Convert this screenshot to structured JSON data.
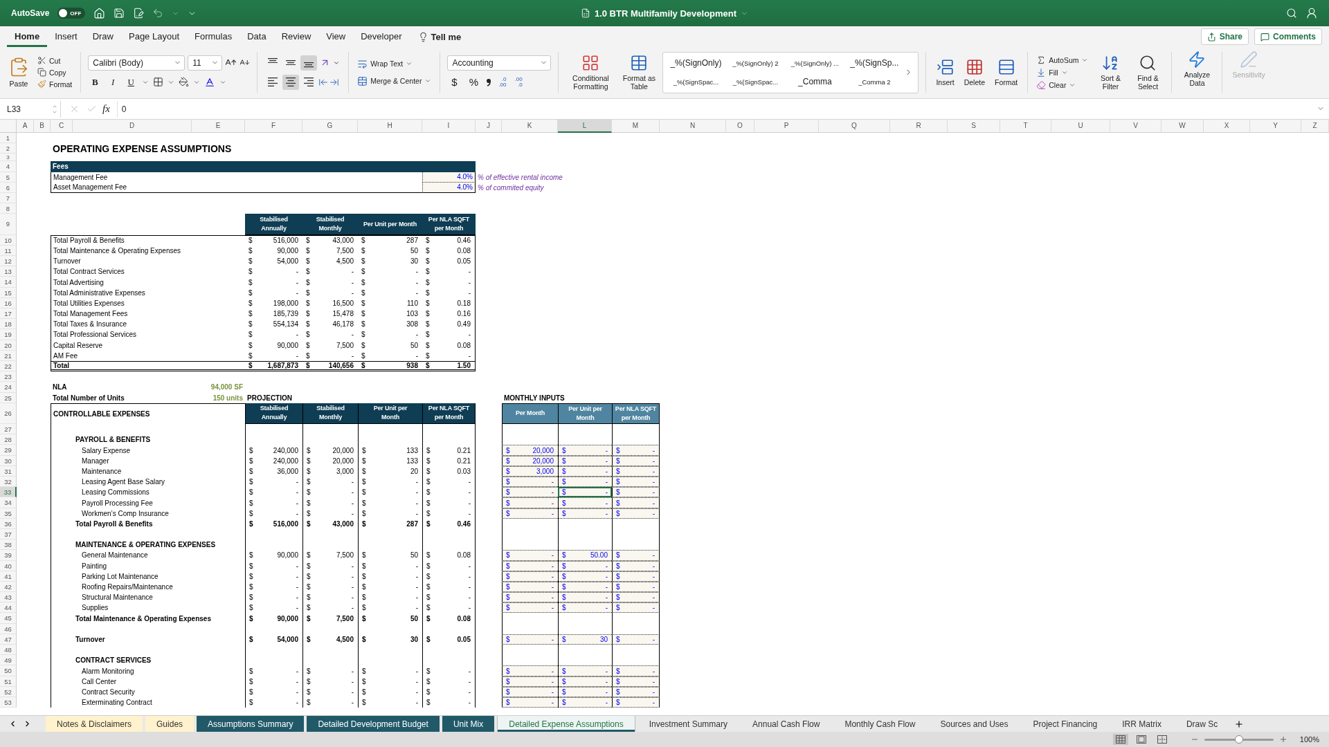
{
  "title_bar": {
    "autosave": "AutoSave",
    "autosave_on": false,
    "autosave_state": "OFF",
    "title": "1.0 BTR Multifamily Development"
  },
  "menu_tabs": [
    {
      "label": "Home",
      "selected": true
    },
    {
      "label": "Insert",
      "selected": false
    },
    {
      "label": "Draw",
      "selected": false
    },
    {
      "label": "Page Layout",
      "selected": false
    },
    {
      "label": "Formulas",
      "selected": false
    },
    {
      "label": "Data",
      "selected": false
    },
    {
      "label": "Review",
      "selected": false
    },
    {
      "label": "View",
      "selected": false
    },
    {
      "label": "Developer",
      "selected": false
    }
  ],
  "tell_me": "Tell me",
  "share": "Share",
  "comments": "Comments",
  "ribbon": {
    "paste": "Paste",
    "clipboard": [
      "Cut",
      "Copy",
      "Format"
    ],
    "font_name": "Calibri (Body)",
    "font_size": "11",
    "format_buttons": [
      "B",
      "I",
      "U"
    ],
    "vertical_align": [
      {
        "kind": "top",
        "selected": false
      },
      {
        "kind": "middle",
        "selected": false
      },
      {
        "kind": "bottom",
        "selected": true
      }
    ],
    "horizontal_align": [
      {
        "kind": "left",
        "selected": false
      },
      {
        "kind": "center",
        "selected": true
      },
      {
        "kind": "right",
        "selected": false
      }
    ],
    "wrap_text": "Wrap Text",
    "merge": "Merge & Center",
    "number_format": "Accounting",
    "number_buttons": [
      "$",
      "%"
    ],
    "decimals": [
      {
        "a": ".0",
        "b": ".00"
      },
      {
        "a": ".00",
        "b": ".0"
      }
    ],
    "conditional": "Conditional Formatting",
    "format_table": "Format as Table",
    "cell_styles": [
      "_%(SignOnly)",
      "_%(SignOnly) 2",
      "_%(SignOnly) ...",
      "_%(SignSp...",
      "_%(SignSpac...",
      "_%(SignSpac...",
      "_Comma",
      "_Comma 2"
    ],
    "cells": [
      "Insert",
      "Delete",
      "Format"
    ],
    "editing": [
      "AutoSum",
      "Fill",
      "Clear"
    ],
    "sort": "Sort & Filter",
    "find": "Find & Select",
    "analyze": "Analyze Data",
    "sensitivity": {
      "label": "Sensitivity",
      "disabled": true
    }
  },
  "formula_bar": {
    "name_box": "L33",
    "fx": "fx",
    "value": "0"
  },
  "columns": [
    {
      "label": "A",
      "selected": false
    },
    {
      "label": "B",
      "selected": false
    },
    {
      "label": "C",
      "selected": false
    },
    {
      "label": "D",
      "selected": false
    },
    {
      "label": "E",
      "selected": false
    },
    {
      "label": "F",
      "selected": false
    },
    {
      "label": "G",
      "selected": false
    },
    {
      "label": "H",
      "selected": false
    },
    {
      "label": "I",
      "selected": false
    },
    {
      "label": "J",
      "selected": false
    },
    {
      "label": "K",
      "selected": false
    },
    {
      "label": "L",
      "selected": true
    },
    {
      "label": "M",
      "selected": false
    },
    {
      "label": "N",
      "selected": false
    },
    {
      "label": "O",
      "selected": false
    },
    {
      "label": "P",
      "selected": false
    },
    {
      "label": "Q",
      "selected": false
    },
    {
      "label": "R",
      "selected": false
    },
    {
      "label": "S",
      "selected": false
    },
    {
      "label": "T",
      "selected": false
    },
    {
      "label": "U",
      "selected": false
    },
    {
      "label": "V",
      "selected": false
    },
    {
      "label": "W",
      "selected": false
    },
    {
      "label": "X",
      "selected": false
    },
    {
      "label": "Y",
      "selected": false
    },
    {
      "label": "Z",
      "selected": false
    }
  ],
  "rows": [
    {
      "n": "1",
      "selected": false,
      "kind": "blank"
    },
    {
      "n": "2",
      "selected": false,
      "kind": "title",
      "text": "OPERATING EXPENSE ASSUMPTIONS"
    },
    {
      "n": "3",
      "selected": false,
      "kind": "spacer"
    },
    {
      "n": "4",
      "selected": false,
      "kind": "fees_header",
      "text": "Fees"
    },
    {
      "n": "5",
      "selected": false,
      "kind": "fee",
      "label": "Management Fee",
      "value": "4.0%",
      "note": "% of effective rental income"
    },
    {
      "n": "6",
      "selected": false,
      "kind": "fee",
      "label": "Asset Management Fee",
      "value": "4.0%",
      "note": "% of commited equity"
    },
    {
      "n": "7",
      "selected": false,
      "kind": "blank"
    },
    {
      "n": "8",
      "selected": false,
      "kind": "blank"
    },
    {
      "n": "9",
      "selected": false,
      "kind": "summary_header",
      "headers": [
        "Stabilised Annually",
        "Stabilised Monthly",
        "Per Unit per Month",
        "Per NLA SQFT per Month"
      ]
    },
    {
      "n": "10",
      "selected": false,
      "kind": "summary",
      "label": "Total Payroll & Benefits",
      "values": [
        [
          "$",
          "516,000"
        ],
        [
          "$",
          "43,000"
        ],
        [
          "$",
          "287"
        ],
        [
          "$",
          "0.46"
        ]
      ]
    },
    {
      "n": "11",
      "selected": false,
      "kind": "summary",
      "label": "Total Maintenance & Operating Expenses",
      "values": [
        [
          "$",
          "90,000"
        ],
        [
          "$",
          "7,500"
        ],
        [
          "$",
          "50"
        ],
        [
          "$",
          "0.08"
        ]
      ]
    },
    {
      "n": "12",
      "selected": false,
      "kind": "summary",
      "label": "Turnover",
      "values": [
        [
          "$",
          "54,000"
        ],
        [
          "$",
          "4,500"
        ],
        [
          "$",
          "30"
        ],
        [
          "$",
          "0.05"
        ]
      ]
    },
    {
      "n": "13",
      "selected": false,
      "kind": "summary",
      "label": "Total Contract Services",
      "values": [
        [
          "$",
          "-"
        ],
        [
          "$",
          "-"
        ],
        [
          "$",
          "-"
        ],
        [
          "$",
          "-"
        ]
      ]
    },
    {
      "n": "14",
      "selected": false,
      "kind": "summary",
      "label": "Total Advertising",
      "values": [
        [
          "$",
          "-"
        ],
        [
          "$",
          "-"
        ],
        [
          "$",
          "-"
        ],
        [
          "$",
          "-"
        ]
      ]
    },
    {
      "n": "15",
      "selected": false,
      "kind": "summary",
      "label": "Total Administrative Expenses",
      "values": [
        [
          "$",
          "-"
        ],
        [
          "$",
          "-"
        ],
        [
          "$",
          "-"
        ],
        [
          "$",
          "-"
        ]
      ]
    },
    {
      "n": "16",
      "selected": false,
      "kind": "summary",
      "label": "Total Utilities Expenses",
      "values": [
        [
          "$",
          "198,000"
        ],
        [
          "$",
          "16,500"
        ],
        [
          "$",
          "110"
        ],
        [
          "$",
          "0.18"
        ]
      ]
    },
    {
      "n": "17",
      "selected": false,
      "kind": "summary",
      "label": "Total Management Fees",
      "values": [
        [
          "$",
          "185,739"
        ],
        [
          "$",
          "15,478"
        ],
        [
          "$",
          "103"
        ],
        [
          "$",
          "0.16"
        ]
      ]
    },
    {
      "n": "18",
      "selected": false,
      "kind": "summary",
      "label": "Total Taxes & Insurance",
      "values": [
        [
          "$",
          "554,134"
        ],
        [
          "$",
          "46,178"
        ],
        [
          "$",
          "308"
        ],
        [
          "$",
          "0.49"
        ]
      ]
    },
    {
      "n": "19",
      "selected": false,
      "kind": "summary",
      "label": "Total Professional Services",
      "values": [
        [
          "$",
          "-"
        ],
        [
          "$",
          "-"
        ],
        [
          "$",
          "-"
        ],
        [
          "$",
          "-"
        ]
      ]
    },
    {
      "n": "20",
      "selected": false,
      "kind": "summary",
      "label": "Capital Reserve",
      "values": [
        [
          "$",
          "90,000"
        ],
        [
          "$",
          "7,500"
        ],
        [
          "$",
          "50"
        ],
        [
          "$",
          "0.08"
        ]
      ]
    },
    {
      "n": "21",
      "selected": false,
      "kind": "summary",
      "label": "AM Fee",
      "values": [
        [
          "$",
          "-"
        ],
        [
          "$",
          "-"
        ],
        [
          "$",
          "-"
        ],
        [
          "$",
          "-"
        ]
      ]
    },
    {
      "n": "22",
      "selected": false,
      "kind": "summary_total",
      "label": "Total",
      "values": [
        [
          "$",
          "1,687,873"
        ],
        [
          "$",
          "140,656"
        ],
        [
          "$",
          "938"
        ],
        [
          "$",
          "1.50"
        ]
      ]
    },
    {
      "n": "23",
      "selected": false,
      "kind": "blank"
    },
    {
      "n": "24",
      "selected": false,
      "kind": "info",
      "label": "NLA",
      "value": "94,000 SF"
    },
    {
      "n": "25",
      "selected": false,
      "kind": "info",
      "label": "Total Number of Units",
      "value": "150 units",
      "projection": "PROJECTION",
      "inputs_title": "MONTHLY INPUTS"
    },
    {
      "n": "26",
      "selected": false,
      "kind": "proj_header",
      "label": "CONTROLLABLE EXPENSES",
      "headers": [
        "Stabilised Annually",
        "Stabilised Monthly",
        "Per Unit per Month",
        "Per NLA SQFT per Month"
      ],
      "input_headers": [
        "Per Month",
        "Per Unit per Month",
        "Per NLA SQFT per Month"
      ]
    },
    {
      "n": "27",
      "selected": false,
      "kind": "proj_blank"
    },
    {
      "n": "28",
      "selected": false,
      "kind": "section",
      "label": "PAYROLL & BENEFITS"
    },
    {
      "n": "29",
      "selected": false,
      "kind": "item",
      "label": "Salary Expense",
      "values": [
        [
          "$",
          "240,000"
        ],
        [
          "$",
          "20,000"
        ],
        [
          "$",
          "133"
        ],
        [
          "$",
          "0.21"
        ]
      ],
      "inputs": [
        {
          "sign": "$",
          "value": "20,000",
          "selected": false
        },
        {
          "sign": "$",
          "value": "-",
          "selected": false
        },
        {
          "sign": "$",
          "value": "-",
          "selected": false
        }
      ]
    },
    {
      "n": "30",
      "selected": false,
      "kind": "item",
      "label": "Manager",
      "values": [
        [
          "$",
          "240,000"
        ],
        [
          "$",
          "20,000"
        ],
        [
          "$",
          "133"
        ],
        [
          "$",
          "0.21"
        ]
      ],
      "inputs": [
        {
          "sign": "$",
          "value": "20,000",
          "selected": false
        },
        {
          "sign": "$",
          "value": "-",
          "selected": false
        },
        {
          "sign": "$",
          "value": "-",
          "selected": false
        }
      ]
    },
    {
      "n": "31",
      "selected": false,
      "kind": "item",
      "label": "Maintenance",
      "values": [
        [
          "$",
          "36,000"
        ],
        [
          "$",
          "3,000"
        ],
        [
          "$",
          "20"
        ],
        [
          "$",
          "0.03"
        ]
      ],
      "inputs": [
        {
          "sign": "$",
          "value": "3,000",
          "selected": false
        },
        {
          "sign": "$",
          "value": "-",
          "selected": false
        },
        {
          "sign": "$",
          "value": "-",
          "selected": false
        }
      ]
    },
    {
      "n": "32",
      "selected": false,
      "kind": "item",
      "label": "Leasing Agent Base Salary",
      "values": [
        [
          "$",
          "-"
        ],
        [
          "$",
          "-"
        ],
        [
          "$",
          "-"
        ],
        [
          "$",
          "-"
        ]
      ],
      "inputs": [
        {
          "sign": "$",
          "value": "-",
          "selected": false
        },
        {
          "sign": "$",
          "value": "-",
          "selected": false
        },
        {
          "sign": "$",
          "value": "-",
          "selected": false
        }
      ]
    },
    {
      "n": "33",
      "selected": true,
      "kind": "item",
      "label": "Leasing Commissions",
      "values": [
        [
          "$",
          "-"
        ],
        [
          "$",
          "-"
        ],
        [
          "$",
          "-"
        ],
        [
          "$",
          "-"
        ]
      ],
      "inputs": [
        {
          "sign": "$",
          "value": "-",
          "selected": false
        },
        {
          "sign": "$",
          "value": "-",
          "selected": true
        },
        {
          "sign": "$",
          "value": "-",
          "selected": false
        }
      ]
    },
    {
      "n": "34",
      "selected": false,
      "kind": "item",
      "label": "Payroll Processing Fee",
      "values": [
        [
          "$",
          "-"
        ],
        [
          "$",
          "-"
        ],
        [
          "$",
          "-"
        ],
        [
          "$",
          "-"
        ]
      ],
      "inputs": [
        {
          "sign": "$",
          "value": "-",
          "selected": false
        },
        {
          "sign": "$",
          "value": "-",
          "selected": false
        },
        {
          "sign": "$",
          "value": "-",
          "selected": false
        }
      ]
    },
    {
      "n": "35",
      "selected": false,
      "kind": "item",
      "label": "Workmen’s Comp Insurance",
      "values": [
        [
          "$",
          "-"
        ],
        [
          "$",
          "-"
        ],
        [
          "$",
          "-"
        ],
        [
          "$",
          "-"
        ]
      ],
      "inputs": [
        {
          "sign": "$",
          "value": "-",
          "selected": false
        },
        {
          "sign": "$",
          "value": "-",
          "selected": false
        },
        {
          "sign": "$",
          "value": "-",
          "selected": false
        }
      ]
    },
    {
      "n": "36",
      "selected": false,
      "kind": "subtotal",
      "label": "Total Payroll & Benefits",
      "values": [
        [
          "$",
          "516,000"
        ],
        [
          "$",
          "43,000"
        ],
        [
          "$",
          "287"
        ],
        [
          "$",
          "0.46"
        ]
      ]
    },
    {
      "n": "37",
      "selected": false,
      "kind": "proj_blank"
    },
    {
      "n": "38",
      "selected": false,
      "kind": "section",
      "label": "MAINTENANCE & OPERATING EXPENSES"
    },
    {
      "n": "39",
      "selected": false,
      "kind": "item",
      "label": "General Maintenance",
      "values": [
        [
          "$",
          "90,000"
        ],
        [
          "$",
          "7,500"
        ],
        [
          "$",
          "50"
        ],
        [
          "$",
          "0.08"
        ]
      ],
      "inputs": [
        {
          "sign": "$",
          "value": "-",
          "selected": false
        },
        {
          "sign": "$",
          "value": "50.00",
          "selected": false
        },
        {
          "sign": "$",
          "value": "-",
          "selected": false
        }
      ]
    },
    {
      "n": "40",
      "selected": false,
      "kind": "item",
      "label": "Painting",
      "values": [
        [
          "$",
          "-"
        ],
        [
          "$",
          "-"
        ],
        [
          "$",
          "-"
        ],
        [
          "$",
          "-"
        ]
      ],
      "inputs": [
        {
          "sign": "$",
          "value": "-",
          "selected": false
        },
        {
          "sign": "$",
          "value": "-",
          "selected": false
        },
        {
          "sign": "$",
          "value": "-",
          "selected": false
        }
      ]
    },
    {
      "n": "41",
      "selected": false,
      "kind": "item",
      "label": "Parking Lot Maintenance",
      "values": [
        [
          "$",
          "-"
        ],
        [
          "$",
          "-"
        ],
        [
          "$",
          "-"
        ],
        [
          "$",
          "-"
        ]
      ],
      "inputs": [
        {
          "sign": "$",
          "value": "-",
          "selected": false
        },
        {
          "sign": "$",
          "value": "-",
          "selected": false
        },
        {
          "sign": "$",
          "value": "-",
          "selected": false
        }
      ]
    },
    {
      "n": "42",
      "selected": false,
      "kind": "item",
      "label": "Roofing Repairs/Maintenance",
      "values": [
        [
          "$",
          "-"
        ],
        [
          "$",
          "-"
        ],
        [
          "$",
          "-"
        ],
        [
          "$",
          "-"
        ]
      ],
      "inputs": [
        {
          "sign": "$",
          "value": "-",
          "selected": false
        },
        {
          "sign": "$",
          "value": "-",
          "selected": false
        },
        {
          "sign": "$",
          "value": "-",
          "selected": false
        }
      ]
    },
    {
      "n": "43",
      "selected": false,
      "kind": "item",
      "label": "Structural Maintenance",
      "values": [
        [
          "$",
          "-"
        ],
        [
          "$",
          "-"
        ],
        [
          "$",
          "-"
        ],
        [
          "$",
          "-"
        ]
      ],
      "inputs": [
        {
          "sign": "$",
          "value": "-",
          "selected": false
        },
        {
          "sign": "$",
          "value": "-",
          "selected": false
        },
        {
          "sign": "$",
          "value": "-",
          "selected": false
        }
      ]
    },
    {
      "n": "44",
      "selected": false,
      "kind": "item",
      "label": "Supplies",
      "values": [
        [
          "$",
          "-"
        ],
        [
          "$",
          "-"
        ],
        [
          "$",
          "-"
        ],
        [
          "$",
          "-"
        ]
      ],
      "inputs": [
        {
          "sign": "$",
          "value": "-",
          "selected": false
        },
        {
          "sign": "$",
          "value": "-",
          "selected": false
        },
        {
          "sign": "$",
          "value": "-",
          "selected": false
        }
      ]
    },
    {
      "n": "45",
      "selected": false,
      "kind": "subtotal",
      "label": "Total Maintenance & Operating Expenses",
      "values": [
        [
          "$",
          "90,000"
        ],
        [
          "$",
          "7,500"
        ],
        [
          "$",
          "50"
        ],
        [
          "$",
          "0.08"
        ]
      ]
    },
    {
      "n": "46",
      "selected": false,
      "kind": "proj_blank"
    },
    {
      "n": "47",
      "selected": false,
      "kind": "subtotal",
      "label": "Turnover",
      "values": [
        [
          "$",
          "54,000"
        ],
        [
          "$",
          "4,500"
        ],
        [
          "$",
          "30"
        ],
        [
          "$",
          "0.05"
        ]
      ],
      "inputs": [
        {
          "sign": "$",
          "value": "-",
          "selected": false
        },
        {
          "sign": "$",
          "value": "30",
          "selected": false
        },
        {
          "sign": "$",
          "value": "-",
          "selected": false
        }
      ]
    },
    {
      "n": "48",
      "selected": false,
      "kind": "proj_blank"
    },
    {
      "n": "49",
      "selected": false,
      "kind": "section",
      "label": "CONTRACT SERVICES"
    },
    {
      "n": "50",
      "selected": false,
      "kind": "item",
      "label": "Alarm Monitoring",
      "values": [
        [
          "$",
          "-"
        ],
        [
          "$",
          "-"
        ],
        [
          "$",
          "-"
        ],
        [
          "$",
          "-"
        ]
      ],
      "inputs": [
        {
          "sign": "$",
          "value": "-",
          "selected": false
        },
        {
          "sign": "$",
          "value": "-",
          "selected": false
        },
        {
          "sign": "$",
          "value": "-",
          "selected": false
        }
      ]
    },
    {
      "n": "51",
      "selected": false,
      "kind": "item",
      "label": "Call Center",
      "values": [
        [
          "$",
          "-"
        ],
        [
          "$",
          "-"
        ],
        [
          "$",
          "-"
        ],
        [
          "$",
          "-"
        ]
      ],
      "inputs": [
        {
          "sign": "$",
          "value": "-",
          "selected": false
        },
        {
          "sign": "$",
          "value": "-",
          "selected": false
        },
        {
          "sign": "$",
          "value": "-",
          "selected": false
        }
      ]
    },
    {
      "n": "52",
      "selected": false,
      "kind": "item",
      "label": "Contract Security",
      "values": [
        [
          "$",
          "-"
        ],
        [
          "$",
          "-"
        ],
        [
          "$",
          "-"
        ],
        [
          "$",
          "-"
        ]
      ],
      "inputs": [
        {
          "sign": "$",
          "value": "-",
          "selected": false
        },
        {
          "sign": "$",
          "value": "-",
          "selected": false
        },
        {
          "sign": "$",
          "value": "-",
          "selected": false
        }
      ]
    },
    {
      "n": "53",
      "selected": false,
      "kind": "item",
      "label": "Exterminating Contract",
      "values": [
        [
          "$",
          "-"
        ],
        [
          "$",
          "-"
        ],
        [
          "$",
          "-"
        ],
        [
          "$",
          "-"
        ]
      ],
      "inputs": [
        {
          "sign": "$",
          "value": "-",
          "selected": false
        },
        {
          "sign": "$",
          "value": "-",
          "selected": false
        },
        {
          "sign": "$",
          "value": "-",
          "selected": false
        }
      ]
    }
  ],
  "sheet_tabs": [
    {
      "label": "Notes & Disclaimers",
      "selected": false,
      "color": "#fff2cc"
    },
    {
      "label": "Guides",
      "selected": false,
      "color": "#fff2cc"
    },
    {
      "label": "Assumptions Summary",
      "selected": false,
      "color": "#215968"
    },
    {
      "label": "Detailed Development Budget",
      "selected": false,
      "color": "#215968"
    },
    {
      "label": "Unit Mix",
      "selected": false,
      "color": "#215968"
    },
    {
      "label": "Detailed Expense Assumptions",
      "selected": true,
      "color": "#215968"
    },
    {
      "label": "Investment Summary",
      "selected": false
    },
    {
      "label": "Annual Cash Flow",
      "selected": false
    },
    {
      "label": "Monthly Cash Flow",
      "selected": false
    },
    {
      "label": "Sources and Uses",
      "selected": false
    },
    {
      "label": "Project Financing",
      "selected": false
    },
    {
      "label": "IRR Matrix",
      "selected": false
    },
    {
      "label": "Draw Sc",
      "selected": false
    }
  ],
  "status_bar": {
    "views": [
      {
        "kind": "normal",
        "selected": true
      },
      {
        "kind": "page_layout",
        "selected": false
      },
      {
        "kind": "page_break",
        "selected": false
      }
    ],
    "zoom": {
      "level": 0.5,
      "text": "100%"
    }
  }
}
